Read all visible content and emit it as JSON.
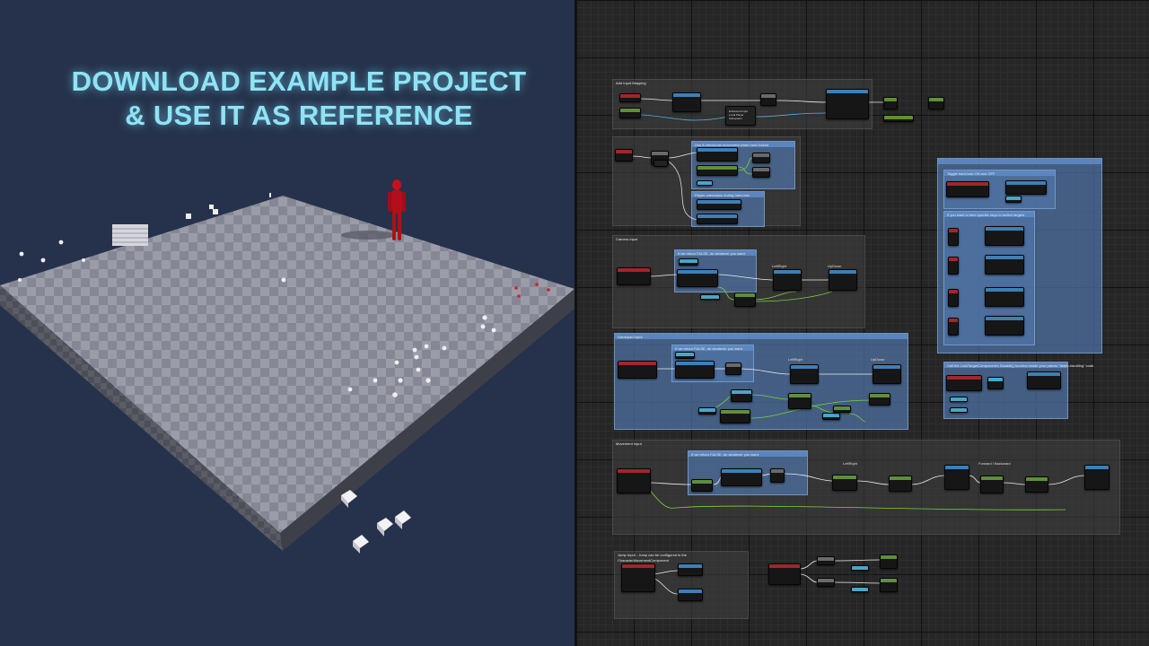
{
  "headline": {
    "line1": "DOWNLOAD EXAMPLE PROJECT",
    "line2": "& USE IT AS REFERENCE"
  },
  "blueprint": {
    "comments": {
      "add_input_mapping": "Add Input Mapping",
      "hard_lock_movement": "Use 8 directional movement when hard locked",
      "orientation_hard_lock": "Player orientation during hard-lock",
      "camera_input": "Camera Input",
      "camera_false": "If we return FALSE, do whatever you want.",
      "gamepad_input": "Gamepad Input",
      "gamepad_false": "If we return FALSE, do whatever you want.",
      "toggle_hard_lock": "Toggle hard-lock ON and OFF",
      "switch_targets": "If you want to bind specific keys to switch targets",
      "lock_target_component": "Call the LockTargetComponent's Disable() function inside your pawns \"death-handling\" code.",
      "movement_input": "Movement Input",
      "movement_false": "If we return FALSE, do whatever you want.",
      "jump_input": "Jump Input - Jump can be configured in the CharacterMovementComponent"
    },
    "labels": {
      "left_right_camera": "LeftRight",
      "up_down_camera": "UpDown",
      "left_right_gamepad": "LeftRight",
      "up_down_gamepad": "UpDown",
      "left_right_move": "LeftRight",
      "forward_backward": "Forward / Backward",
      "subsystem": "Enhanced Input Local Player Subsystem"
    }
  },
  "colors": {
    "headline": "#8fe4f4",
    "floor": "#8e909c",
    "character": "#c4121c",
    "comment_blue": "#5076aa",
    "graph_bg": "#262626"
  }
}
